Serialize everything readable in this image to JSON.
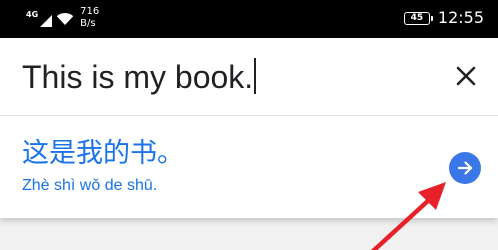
{
  "status_bar": {
    "network": "4G",
    "speed_value": "716",
    "speed_unit": "B/s",
    "battery": "45",
    "time": "12:55"
  },
  "input": {
    "source_text": "This is my book."
  },
  "result": {
    "translation": "这是我的书。",
    "pinyin": "Zhè shì wǒ de shū."
  },
  "colors": {
    "accent": "#1a73e8",
    "go_button": "#3b78e7",
    "annotation_arrow": "#e8202a",
    "status_bar_bg": "#000000"
  },
  "icons": {
    "close": "close-icon",
    "go": "arrow-right-icon",
    "wifi": "wifi-icon",
    "signal": "signal-icon"
  }
}
